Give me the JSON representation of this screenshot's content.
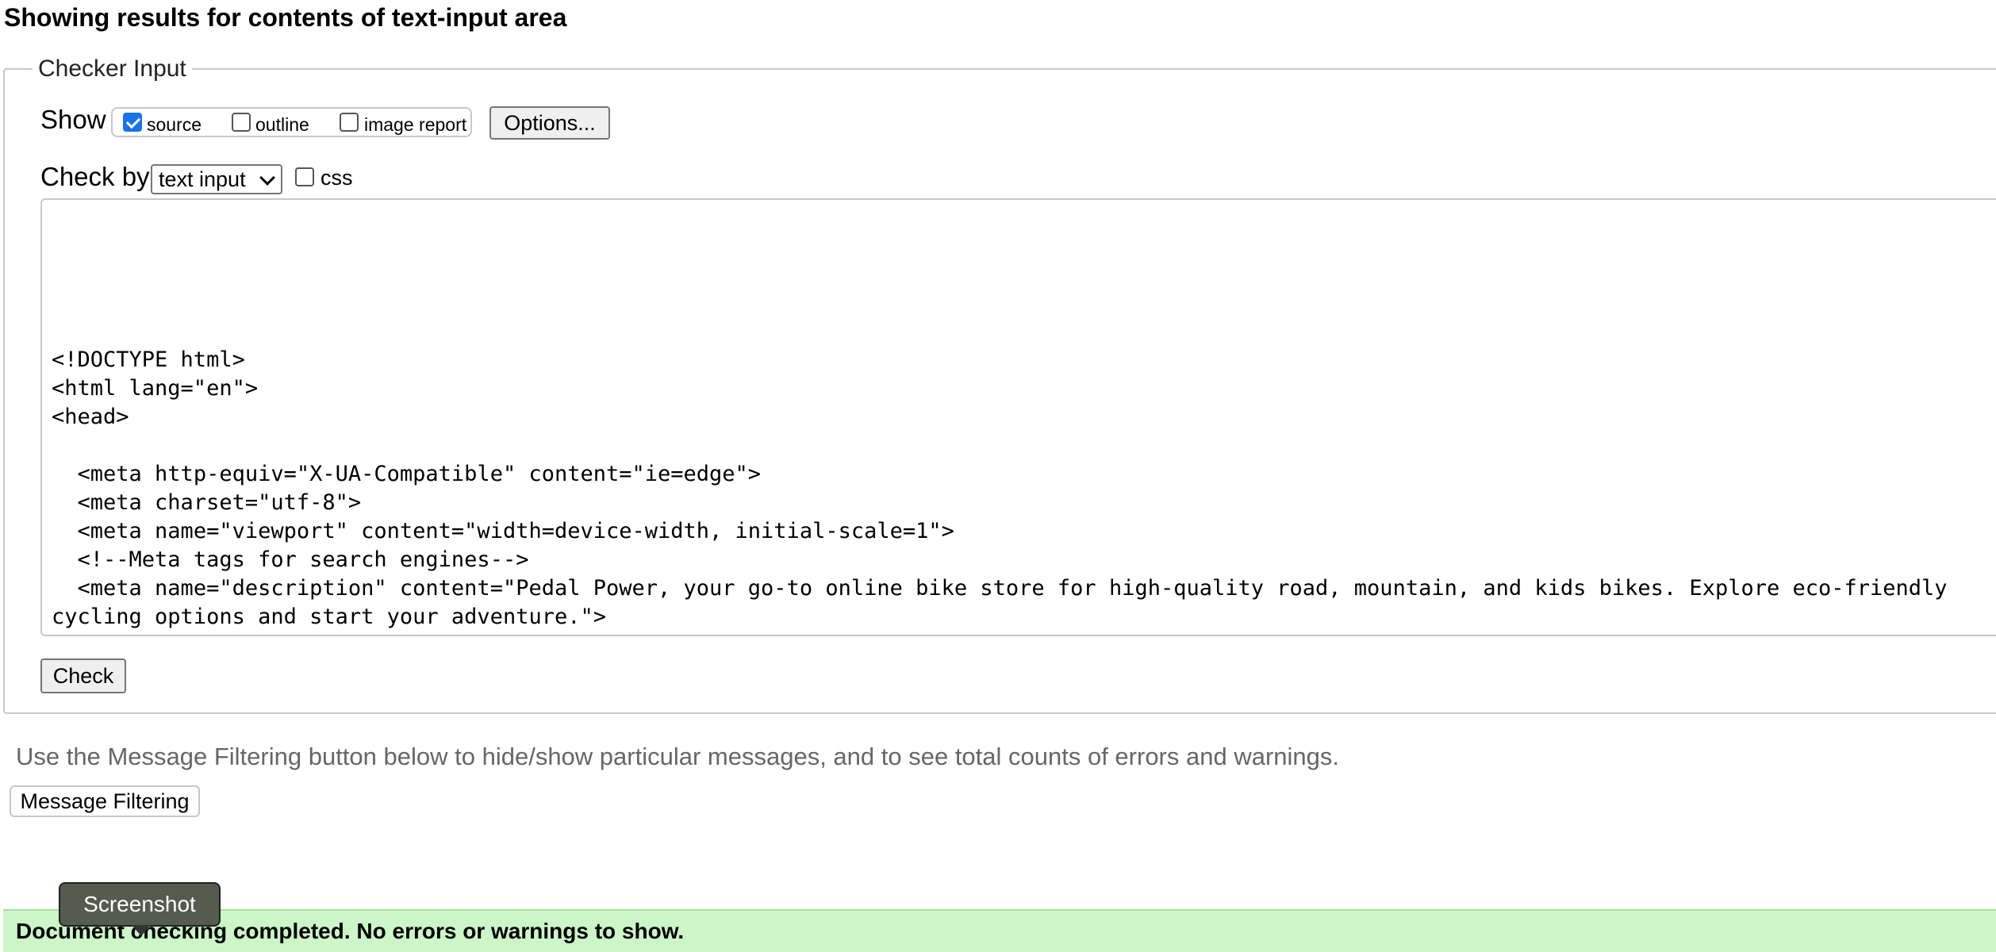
{
  "page": {
    "heading": "Showing results for contents of text-input area"
  },
  "checker_input": {
    "legend": "Checker Input",
    "show_label": "Show",
    "show_options": [
      {
        "label": "source",
        "checked": true
      },
      {
        "label": "outline",
        "checked": false
      },
      {
        "label": "image report",
        "checked": false
      }
    ],
    "options_button": "Options...",
    "check_by_label": "Check by",
    "check_by_select": "text input",
    "css_checkbox": {
      "label": "css",
      "checked": false
    },
    "textarea_content": "<!DOCTYPE html>\n<html lang=\"en\">\n<head>\n\n  <meta http-equiv=\"X-UA-Compatible\" content=\"ie=edge\">\n  <meta charset=\"utf-8\">\n  <meta name=\"viewport\" content=\"width=device-width, initial-scale=1\">\n  <!--Meta tags for search engines-->\n  <meta name=\"description\" content=\"Pedal Power, your go-to online bike store for high-quality road, mountain, and kids bikes. Explore eco-friendly cycling options and start your adventure.\">\n  <meta name=\"keywords\" content=\"bikes, pedal, power, bicycle, cycle, road, mountain, kids, explore, adventure, eco-friendly, environment\">\n  <meta name=\"author\" content=\"Lee Copeman\">",
    "check_button": "Check"
  },
  "filtering": {
    "hint": "Use the Message Filtering button below to hide/show particular messages, and to see total counts of errors and warnings.",
    "button": "Message Filtering"
  },
  "result": {
    "message": "Document checking completed. No errors or warnings to show.",
    "color": "#ccf5c8"
  },
  "tooltip": {
    "label": "Screenshot"
  }
}
